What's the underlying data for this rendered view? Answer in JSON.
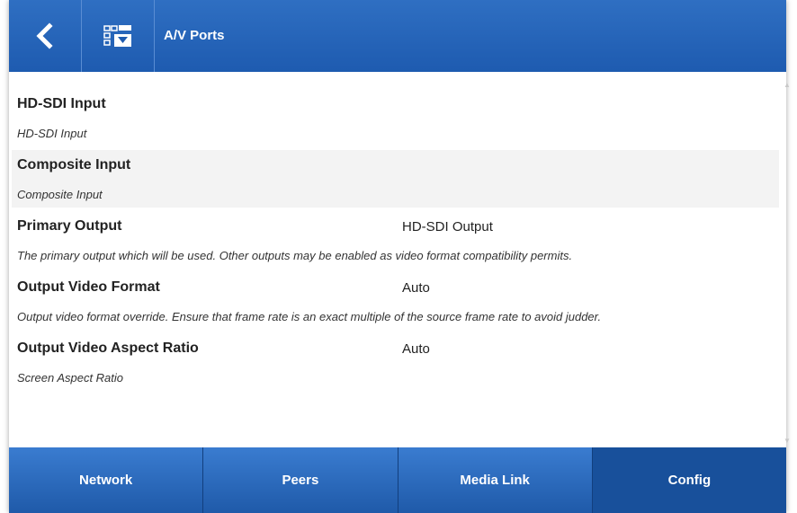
{
  "header": {
    "title": "A/V Ports",
    "back_icon": "chevron-left-icon",
    "action_icon": "list-download-icon"
  },
  "items": [
    {
      "title": "HD-SDI Input",
      "value": "",
      "desc": "HD-SDI Input"
    },
    {
      "title": "Composite Input",
      "value": "",
      "desc": "Composite Input"
    },
    {
      "title": "Primary Output",
      "value": "HD-SDI Output",
      "desc": "The primary output which will be used. Other outputs may be enabled as video format compatibility permits."
    },
    {
      "title": "Output Video Format",
      "value": "Auto",
      "desc": "Output video format override. Ensure that frame rate is an exact multiple of the source frame rate to avoid judder."
    },
    {
      "title": "Output Video Aspect Ratio",
      "value": "Auto",
      "desc": "Screen Aspect Ratio"
    }
  ],
  "tabs": [
    {
      "label": "Network",
      "active": false
    },
    {
      "label": "Peers",
      "active": false
    },
    {
      "label": "Media Link",
      "active": false
    },
    {
      "label": "Config",
      "active": true
    }
  ],
  "colors": {
    "header": "#1e5bb0",
    "tab": "#2a6cc4",
    "tab_active": "#18509b"
  }
}
